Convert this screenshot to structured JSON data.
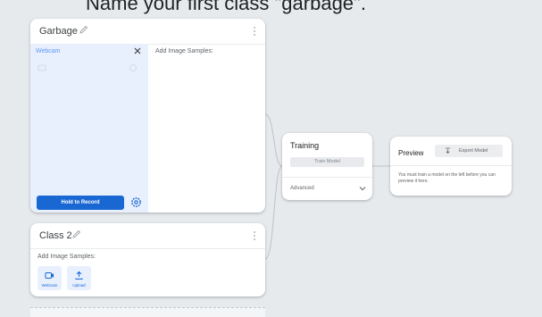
{
  "caption": "Name your first class \"garbage\".",
  "garbage_card": {
    "title": "Garbage",
    "webcam_label": "Webcam",
    "samples_label": "Add Image Samples:",
    "record_button": "Hold to Record",
    "icons": [
      "pencil-icon",
      "kebab-menu-icon",
      "close-icon",
      "settings-icon"
    ]
  },
  "class2_card": {
    "title": "Class 2",
    "samples_label": "Add Image Samples:",
    "webcam_button": "Webcam",
    "upload_button": "Upload",
    "icons": [
      "pencil-icon",
      "kebab-menu-icon",
      "webcam-icon",
      "upload-icon"
    ]
  },
  "training_card": {
    "title": "Training",
    "train_button": "Train Model",
    "advanced_label": "Advanced",
    "icons": [
      "chevron-down-icon"
    ]
  },
  "preview_card": {
    "title": "Preview",
    "export_button": "Export Model",
    "message": "You must train a model on the left before you can preview it here.",
    "icons": [
      "export-icon"
    ]
  },
  "colors": {
    "background": "#e7eaed",
    "card": "#ffffff",
    "webcam_panel": "#e8f0fe",
    "accent": "#1967d2",
    "disabled_button": "#e8eaed"
  }
}
